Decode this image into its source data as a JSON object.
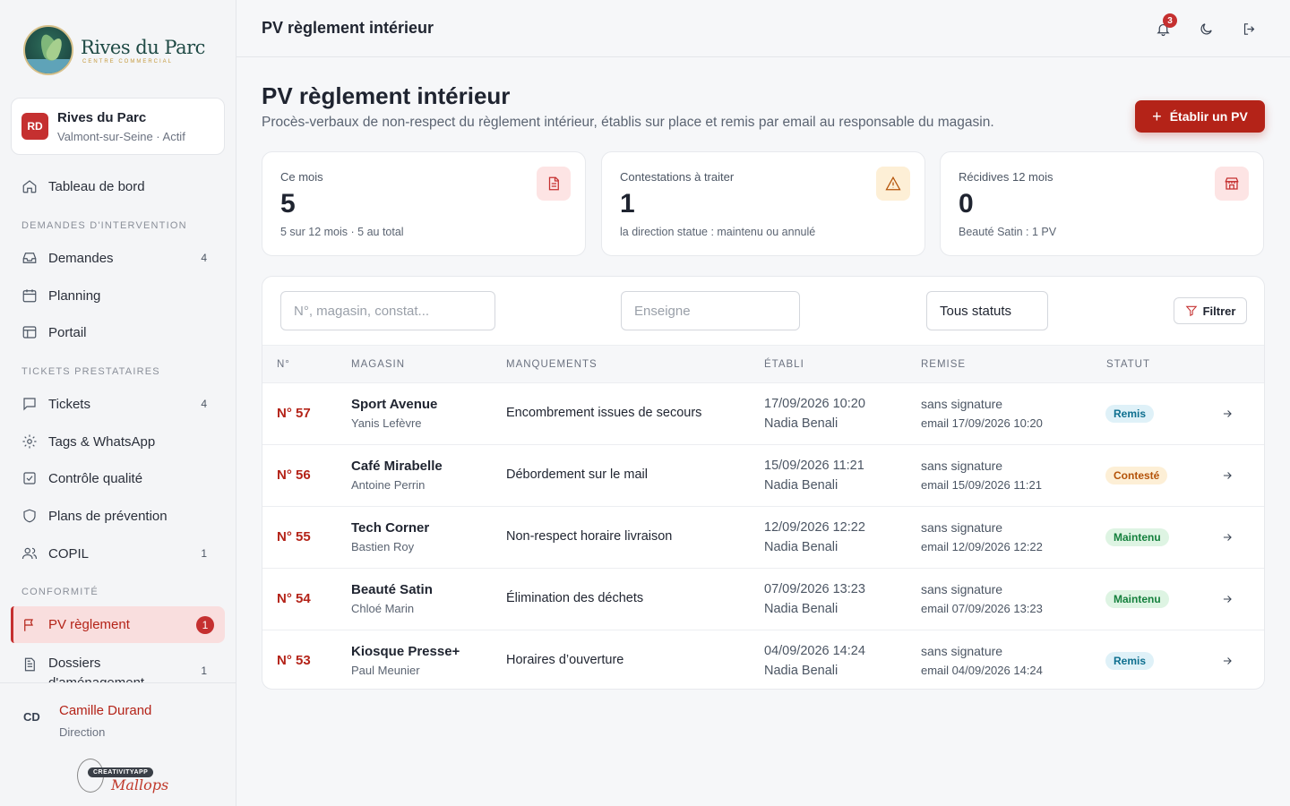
{
  "brand": {
    "name": "Rives du Parc",
    "tagline": "CENTRE COMMERCIAL"
  },
  "site": {
    "initials": "RD",
    "name": "Rives du Parc",
    "meta": "Valmont-sur-Seine · Actif"
  },
  "nav": {
    "dashboard": {
      "label": "Tableau de bord"
    },
    "section_demandes": "DEMANDES D'INTERVENTION",
    "demandes": {
      "label": "Demandes",
      "count": "4"
    },
    "planning": {
      "label": "Planning"
    },
    "portail": {
      "label": "Portail"
    },
    "section_tickets": "TICKETS PRESTATAIRES",
    "tickets": {
      "label": "Tickets",
      "count": "4"
    },
    "tags": {
      "label": "Tags & WhatsApp"
    },
    "controle": {
      "label": "Contrôle qualité"
    },
    "plans": {
      "label": "Plans de prévention"
    },
    "copil": {
      "label": "COPIL",
      "count": "1"
    },
    "section_conformite": "CONFORMITÉ",
    "pv": {
      "label": "PV règlement",
      "count": "1"
    },
    "dossiers": {
      "label": "Dossiers d'aménagement",
      "count": "1"
    }
  },
  "user": {
    "initials": "CD",
    "name": "Camille Durand",
    "role": "Direction"
  },
  "credit": {
    "pill": "CREATIVITYAPP",
    "script": "Mallops"
  },
  "topbar": {
    "title": "PV règlement intérieur",
    "notifications": "3"
  },
  "header": {
    "title": "PV règlement intérieur",
    "subtitle": "Procès-verbaux de non-respect du règlement intérieur, établis sur place et remis par email au responsable du magasin.",
    "cta": "Établir un PV"
  },
  "stats": [
    {
      "label": "Ce mois",
      "value": "5",
      "note": "5 sur 12 mois · 5 au total"
    },
    {
      "label": "Contestations à traiter",
      "value": "1",
      "note": "la direction statue : maintenu ou annulé"
    },
    {
      "label": "Récidives 12 mois",
      "value": "0",
      "note": "Beauté Satin : 1 PV"
    }
  ],
  "filters": {
    "search_placeholder": "N°, magasin, constat...",
    "brand_placeholder": "Enseigne",
    "status_value": "Tous statuts",
    "filter_button": "Filtrer"
  },
  "table": {
    "headers": {
      "no": "N°",
      "magasin": "MAGASIN",
      "manquements": "MANQUEMENTS",
      "etabli": "ÉTABLI",
      "remise": "REMISE",
      "statut": "STATUT"
    },
    "rows": [
      {
        "no": "N° 57",
        "shop": "Sport Avenue",
        "person": "Yanis Lefèvre",
        "issue": "Encombrement issues de secours",
        "date": "17/09/2026 10:20",
        "agent": "Nadia Benali",
        "remise": "sans signature",
        "remise_detail": "email 17/09/2026 10:20",
        "status": "Remis"
      },
      {
        "no": "N° 56",
        "shop": "Café Mirabelle",
        "person": "Antoine Perrin",
        "issue": "Débordement sur le mail",
        "date": "15/09/2026 11:21",
        "agent": "Nadia Benali",
        "remise": "sans signature",
        "remise_detail": "email 15/09/2026 11:21",
        "status": "Contesté"
      },
      {
        "no": "N° 55",
        "shop": "Tech Corner",
        "person": "Bastien Roy",
        "issue": "Non-respect horaire livraison",
        "date": "12/09/2026 12:22",
        "agent": "Nadia Benali",
        "remise": "sans signature",
        "remise_detail": "email 12/09/2026 12:22",
        "status": "Maintenu"
      },
      {
        "no": "N° 54",
        "shop": "Beauté Satin",
        "person": "Chloé Marin",
        "issue": "Élimination des déchets",
        "date": "07/09/2026 13:23",
        "agent": "Nadia Benali",
        "remise": "sans signature",
        "remise_detail": "email 07/09/2026 13:23",
        "status": "Maintenu"
      },
      {
        "no": "N° 53",
        "shop": "Kiosque Presse+",
        "person": "Paul Meunier",
        "issue": "Horaires d’ouverture",
        "date": "04/09/2026 14:24",
        "agent": "Nadia Benali",
        "remise": "sans signature",
        "remise_detail": "email 04/09/2026 14:24",
        "status": "Remis"
      }
    ]
  }
}
